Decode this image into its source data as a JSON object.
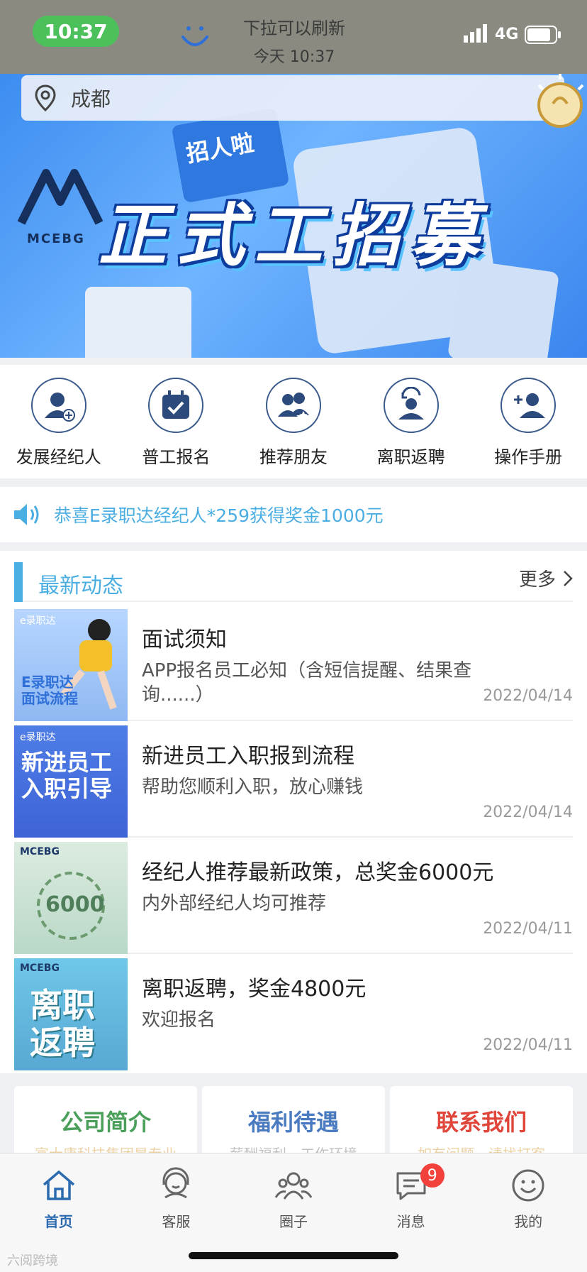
{
  "status": {
    "time": "10:37",
    "network": "4G",
    "refresh_hint": "下拉可以刷新",
    "refresh_time": "今天 10:37"
  },
  "location": {
    "city": "成都"
  },
  "banner": {
    "tag": "招人啦",
    "headline": "正式工招募",
    "logo_text": "MCEBG",
    "slide_count": 3,
    "active_slide": 2
  },
  "actions": [
    {
      "label": "发展经纪人",
      "icon": "user-add-icon"
    },
    {
      "label": "普工报名",
      "icon": "calendar-check-icon"
    },
    {
      "label": "推荐朋友",
      "icon": "users-star-icon"
    },
    {
      "label": "离职返聘",
      "icon": "user-return-icon"
    },
    {
      "label": "操作手册",
      "icon": "user-plus-icon"
    }
  ],
  "notice": {
    "text": "恭喜E录职达经纪人*259获得奖金1000元"
  },
  "news": {
    "title": "最新动态",
    "more": "更多",
    "items": [
      {
        "title": "面试须知",
        "desc": "APP报名员工必知（含短信提醒、结果查询......）",
        "date": "2022/04/14",
        "thumb_text": "E录职达\n面试流程",
        "thumb_small": "e录职达"
      },
      {
        "title": "新进员工入职报到流程",
        "desc": "帮助您顺利入职，放心赚钱",
        "date": "2022/04/14",
        "thumb_text": "新进员工\n入职引导",
        "thumb_small": "e录职达"
      },
      {
        "title": "经纪人推荐最新政策，总奖金6000元",
        "desc": "内外部经纪人均可推荐",
        "date": "2022/04/11",
        "thumb_text": "6000",
        "thumb_small": "MCEBG"
      },
      {
        "title": "离职返聘，奖金4800元",
        "desc": "欢迎报名",
        "date": "2022/04/11",
        "thumb_text": "离职\n返聘",
        "thumb_small": "MCEBG"
      }
    ]
  },
  "cards": [
    {
      "title": "公司简介",
      "sub": "富士康科技集团是专业",
      "color": "#4aa05a"
    },
    {
      "title": "福利待遇",
      "sub": "薪酬福利、工作环境",
      "color": "#4a7ac0"
    },
    {
      "title": "联系我们",
      "sub": "如有问题，请找打客",
      "color": "#e0453a"
    }
  ],
  "tabs": [
    {
      "label": "首页",
      "icon": "home-icon"
    },
    {
      "label": "客服",
      "icon": "headset-icon"
    },
    {
      "label": "圈子",
      "icon": "group-icon"
    },
    {
      "label": "消息",
      "icon": "message-icon",
      "badge": "9"
    },
    {
      "label": "我的",
      "icon": "smile-icon"
    }
  ],
  "watermark": "六阅跨境",
  "colors": {
    "accent": "#4aaee2",
    "tab_active": "#2c6ab0",
    "badge": "#f2413b"
  }
}
